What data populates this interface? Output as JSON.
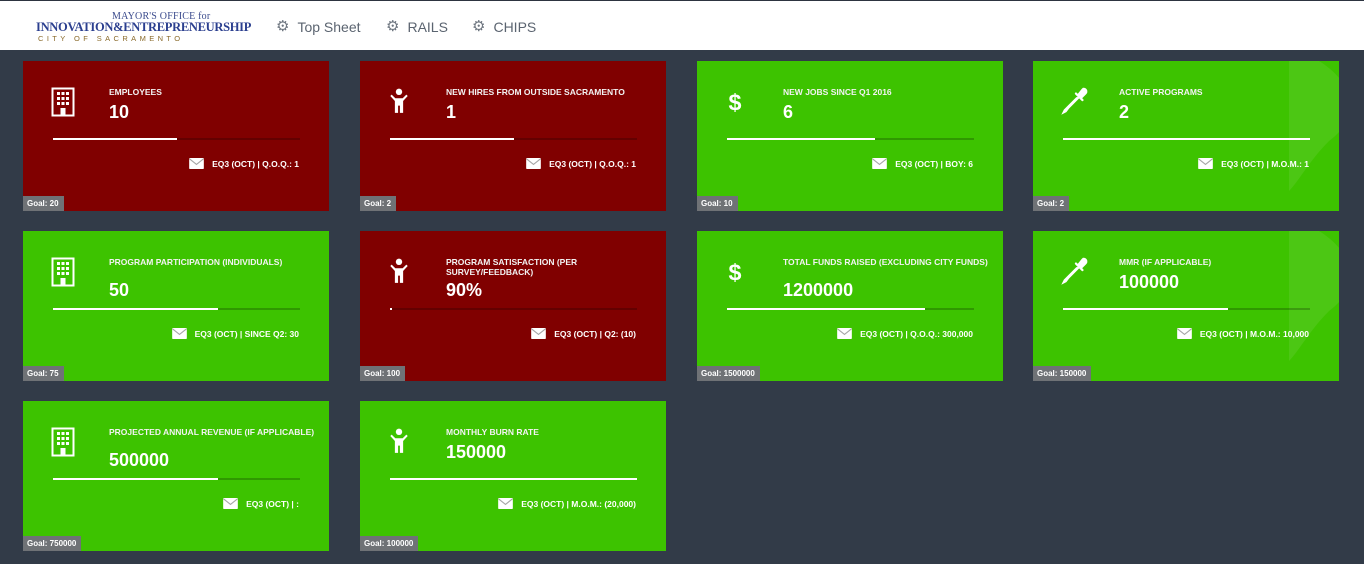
{
  "header": {
    "logo": {
      "line1": "MAYOR'S OFFICE for",
      "line2": "INNOVATION&ENTREPRENEURSHIP",
      "line3": "CITY OF SACRAMENTO"
    },
    "nav": [
      {
        "label": "Top Sheet",
        "icon": "gear-icon"
      },
      {
        "label": "RAILS",
        "icon": "gear-icon"
      },
      {
        "label": "CHIPS",
        "icon": "gear-icon"
      }
    ]
  },
  "colors": {
    "red": "#800000",
    "green": "#3dc300",
    "background": "#323b48"
  },
  "tiles": [
    {
      "icon": "building-icon",
      "status": "red",
      "label": "EMPLOYEES",
      "value": "10",
      "footer": "EQ3 (OCT) | Q.O.Q.: 1",
      "goal": "Goal: 20",
      "progress": 0.5
    },
    {
      "icon": "person-icon",
      "status": "red",
      "label": "NEW HIRES FROM OUTSIDE SACRAMENTO",
      "value": "1",
      "footer": "EQ3 (OCT) | Q.O.Q.: 1",
      "goal": "Goal: 2",
      "progress": 0.5
    },
    {
      "icon": "dollar-icon",
      "status": "green",
      "label": "NEW JOBS SINCE Q1 2016",
      "value": "6",
      "footer": "EQ3 (OCT) | BOY: 6",
      "goal": "Goal: 10",
      "progress": 0.6
    },
    {
      "icon": "dropper-icon",
      "status": "green",
      "label": "ACTIVE PROGRAMS",
      "value": "2",
      "footer": "EQ3 (OCT) | M.O.M.: 1",
      "goal": "Goal: 2",
      "progress": 1.0
    },
    {
      "icon": "building-icon",
      "status": "green",
      "label": "PROGRAM PARTICIPATION (INDIVIDUALS)",
      "value": "50",
      "footer": "EQ3 (OCT) | SINCE Q2: 30",
      "goal": "Goal: 75",
      "progress": 0.67
    },
    {
      "icon": "person-icon",
      "status": "red",
      "label": "PROGRAM SATISFACTION (PER SURVEY/FEEDBACK)",
      "value": "90%",
      "footer": "EQ3 (OCT) | Q2: (10)",
      "goal": "Goal: 100",
      "progress": 0.01
    },
    {
      "icon": "dollar-icon",
      "status": "green",
      "label": "TOTAL FUNDS RAISED (EXCLUDING CITY FUNDS)",
      "value": "1200000",
      "footer": "EQ3 (OCT) | Q.O.Q.: 300,000",
      "goal": "Goal: 1500000",
      "progress": 0.8
    },
    {
      "icon": "dropper-icon",
      "status": "green",
      "label": "MMR (IF APPLICABLE)",
      "value": "100000",
      "footer": "EQ3 (OCT) | M.O.M.: 10,000",
      "goal": "Goal: 150000",
      "progress": 0.67
    },
    {
      "icon": "building-icon",
      "status": "green",
      "label": "PROJECTED ANNUAL REVENUE (IF APPLICABLE)",
      "value": "500000",
      "footer": "EQ3 (OCT) | :",
      "goal": "Goal: 750000",
      "progress": 0.67
    },
    {
      "icon": "person-icon",
      "status": "green",
      "label": "MONTHLY BURN RATE",
      "value": "150000",
      "footer": "EQ3 (OCT) | M.O.M.: (20,000)",
      "goal": "Goal: 100000",
      "progress": 1.0
    }
  ]
}
